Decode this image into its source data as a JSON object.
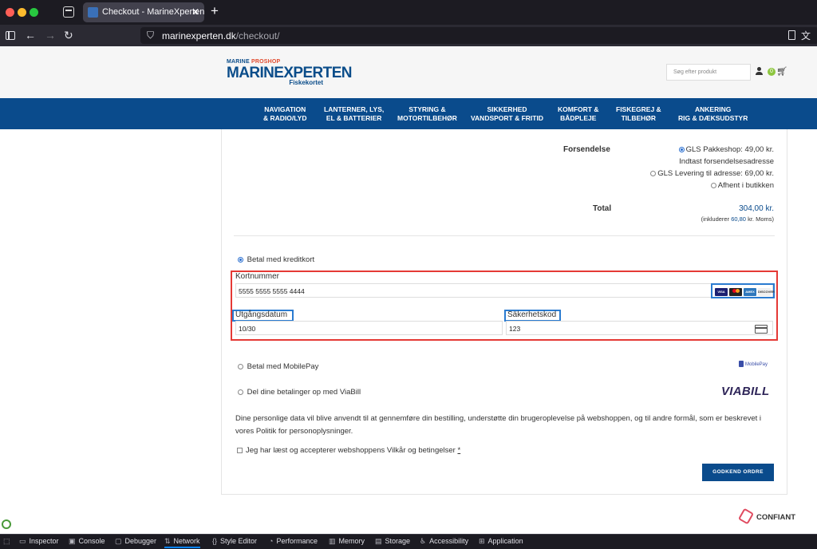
{
  "browser": {
    "tab_title": "Checkout - MarineXperten",
    "url_domain": "marinexperten.dk",
    "url_path": "/checkout/"
  },
  "header": {
    "logo_top": "MARINE",
    "logo_top_accent": "PROSHOP",
    "logo_main": "MARINEXPERTEN",
    "logo_sub": "Fiskekortet",
    "search_placeholder": "Søg efter produkt",
    "cart_count": "0"
  },
  "nav": [
    {
      "label": "NAVIGATION\n& RADIO/LYD"
    },
    {
      "label": "LANTERNER, LYS,\nEL & BATTERIER"
    },
    {
      "label": "STYRING &\nMOTORTILBEHØR"
    },
    {
      "label": "SIKKERHED\nVANDSPORT & FRITID"
    },
    {
      "label": "KOMFORT &\nBÅDPLEJE"
    },
    {
      "label": "FISKEGREJ &\nTILBEHØR"
    },
    {
      "label": "ANKERING\nRIG & DÆKSUDSTYR"
    }
  ],
  "shipping": {
    "label": "Forsendelse",
    "option1": "GLS Pakkeshop: 49,00 kr.",
    "address_note": "Indtast forsendelsesadresse",
    "option2": "GLS Levering til adresse: 69,00 kr.",
    "option3": "Afhent i butikken"
  },
  "total": {
    "label": "Total",
    "value": "304,00 kr.",
    "vat_prefix": "(inkluderer",
    "vat_value": "60,80",
    "vat_suffix": "kr. Moms)"
  },
  "payment": {
    "credit_card_label": "Betal med kreditkort",
    "card_number_label": "Kortnummer",
    "card_number_value": "5555 5555 5555 4444",
    "expiry_label": "Utgångsdatum",
    "expiry_value": "10/30",
    "cvc_label": "Säkerhetskod",
    "cvc_value": "123",
    "mobilepay_label": "Betal med MobilePay",
    "mobilepay_logo": "MobilePay",
    "viabill_label": "Del dine betalinger op med ViaBill",
    "viabill_logo": "VIABILL",
    "card_logos": [
      "VISA",
      "MC",
      "AMEX",
      "DISCOVER"
    ]
  },
  "privacy_text": "Dine personlige data vil blive anvendt til at gennemføre din bestilling, understøtte din brugeroplevelse på webshoppen, og til andre formål, som er beskrevet i vores Politik for personoplysninger.",
  "terms_text": "Jeg har læst og accepterer webshoppens Vilkår og betingelser",
  "terms_star": "*",
  "order_button": "GODKEND ORDRE",
  "confiant": "CONFIANT",
  "devtools": [
    "Inspector",
    "Console",
    "Debugger",
    "Network",
    "Style Editor",
    "Performance",
    "Memory",
    "Storage",
    "Accessibility",
    "Application"
  ],
  "colors": {
    "brand_blue": "#0a4b8c",
    "highlight_red": "#e53935",
    "highlight_blue": "#2a7bd0"
  }
}
